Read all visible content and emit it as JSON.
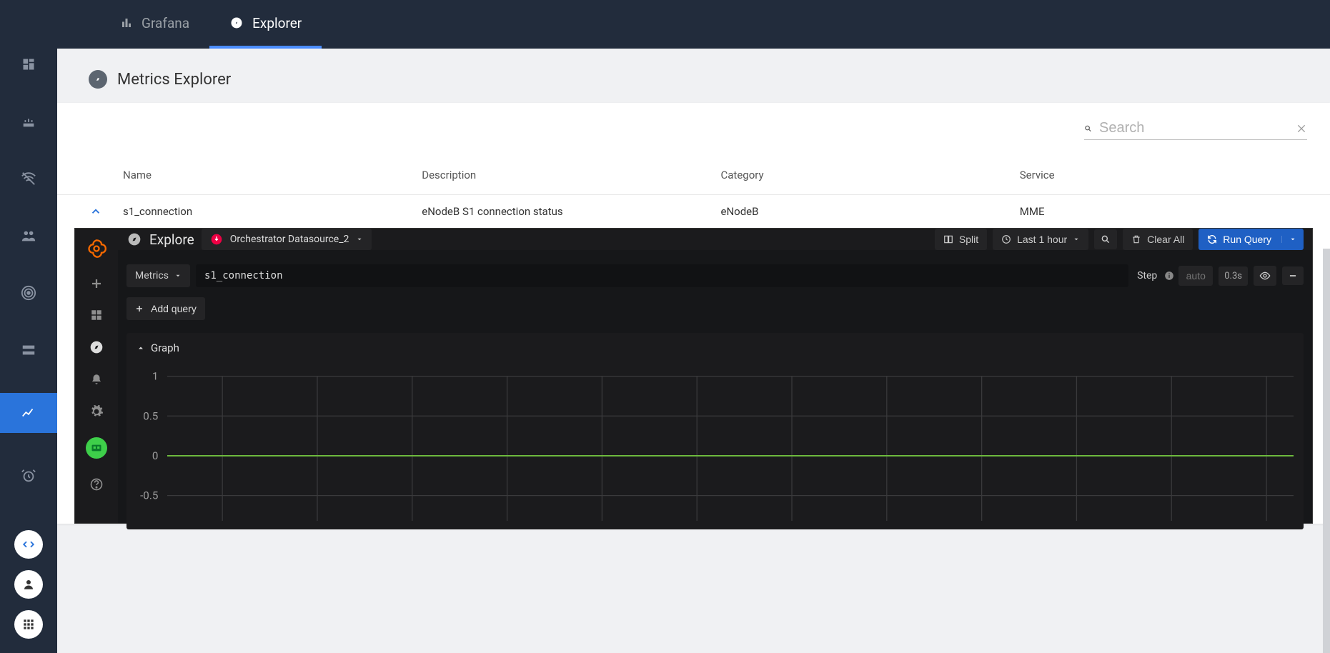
{
  "topbar": {
    "tabs": [
      {
        "label": "Grafana",
        "active": false
      },
      {
        "label": "Explorer",
        "active": true
      }
    ]
  },
  "page": {
    "title": "Metrics Explorer"
  },
  "search": {
    "placeholder": "Search"
  },
  "table": {
    "headers": {
      "name": "Name",
      "description": "Description",
      "category": "Category",
      "service": "Service"
    },
    "rows": [
      {
        "name": "s1_connection",
        "description": "eNodeB S1 connection status",
        "category": "eNodeB",
        "service": "MME"
      }
    ]
  },
  "grafana": {
    "explore_title": "Explore",
    "datasource": "Orchestrator Datasource_2",
    "toolbar": {
      "split": "Split",
      "timerange": "Last 1 hour",
      "clear_all": "Clear All",
      "run_query": "Run Query"
    },
    "query": {
      "metrics_label": "Metrics",
      "value": "s1_connection",
      "step_label": "Step",
      "step_placeholder": "auto",
      "timing": "0.3s",
      "add_query": "Add query"
    },
    "graph": {
      "title": "Graph"
    }
  },
  "chart_data": {
    "type": "line",
    "title": "Graph",
    "ylabel": "",
    "ylim": [
      -1.0,
      1.0
    ],
    "yticks": [
      1.0,
      0.5,
      0.0,
      -0.5
    ],
    "series": [
      {
        "name": "s1_connection",
        "values": [
          0,
          0,
          0,
          0,
          0,
          0,
          0,
          0,
          0,
          0,
          0,
          0
        ]
      }
    ]
  }
}
